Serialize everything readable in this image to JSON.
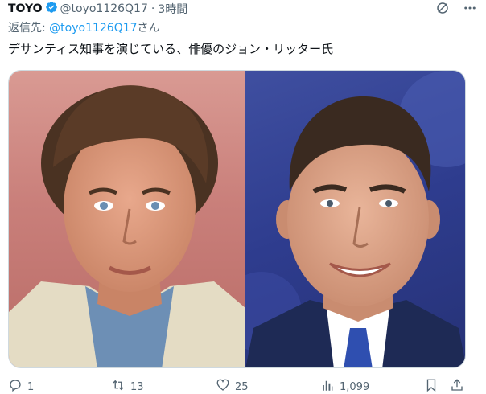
{
  "tweet": {
    "display_name": "TOYO",
    "handle": "@toyo1126Q17",
    "separator": "·",
    "time": "3時間",
    "reply_prefix": "返信先: ",
    "reply_mention": "@toyo1126Q17",
    "reply_suffix": "さん",
    "text": "デサンティス知事を演じている、俳優のジョン・リッター氏"
  },
  "media": {
    "left_photo": "portrait-photo",
    "right_photo": "portrait-photo"
  },
  "actions": {
    "replies": "1",
    "retweets": "13",
    "likes": "25",
    "views": "1,099"
  },
  "icons": {
    "verified": "verified-badge-icon",
    "grok": "grok-icon",
    "more": "more-icon",
    "reply": "reply-icon",
    "retweet": "retweet-icon",
    "like": "heart-icon",
    "views": "views-icon",
    "bookmark": "bookmark-icon",
    "share": "share-icon"
  },
  "colors": {
    "link": "#1d9bf0",
    "muted": "#536471",
    "text": "#0f1419"
  }
}
